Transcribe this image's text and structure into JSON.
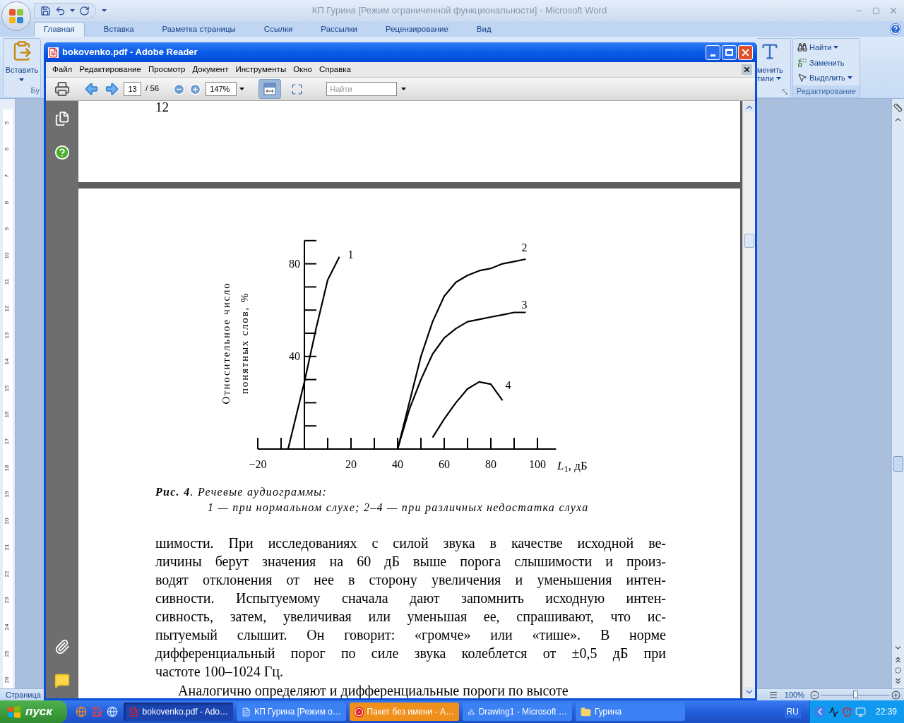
{
  "word_window": {
    "title": "КП Гурина [Режим ограниченной функциональности] - Microsoft Word",
    "tabs": [
      {
        "label": "Главная",
        "selected": true
      },
      {
        "label": "Вставка",
        "selected": false
      },
      {
        "label": "Разметка страницы",
        "selected": false
      },
      {
        "label": "Ссылки",
        "selected": false
      },
      {
        "label": "Рассылки",
        "selected": false
      },
      {
        "label": "Рецензирование",
        "selected": false
      },
      {
        "label": "Вид",
        "selected": false
      }
    ],
    "ribbon": {
      "paste_label": "Вставить",
      "clipboard_group_label": "Бу",
      "styles_label_lines": [
        "менить",
        "тили"
      ],
      "find": "Найти",
      "replace": "Заменить",
      "select": "Выделить",
      "editing_group_label": "Редактирование"
    },
    "ruler_numbers": [
      "5",
      "6",
      "7",
      "8",
      "9",
      "10",
      "11",
      "12",
      "13",
      "14",
      "15",
      "16",
      "17",
      "18",
      "19",
      "20",
      "21",
      "22",
      "23",
      "24",
      "25",
      "26"
    ],
    "status_bar": {
      "page": "Страница",
      "zoom": "100%",
      "zoom_slider": {
        "level": 0.5
      }
    }
  },
  "reader_window": {
    "title": "bokovenko.pdf - Adobe Reader",
    "menu": [
      "Файл",
      "Редактирование",
      "Просмотр",
      "Документ",
      "Инструменты",
      "Окно",
      "Справка"
    ],
    "toolbar": {
      "page": "13",
      "page_count": "/ 56",
      "zoom": "147%",
      "search_placeholder": "Найти",
      "toggles": [
        {
          "kind": "fit-width",
          "selected": true
        },
        {
          "kind": "fit-page",
          "selected": false
        }
      ]
    },
    "document": {
      "prev_page_number": "12",
      "figure": {
        "chart_data": {
          "type": "line",
          "xlabel": "*L*$_{1}$, дБ",
          "ylabel": "Относительное  число понятных слов, %",
          "x": [
            -10,
            -7,
            0,
            5,
            10,
            15,
            40,
            45,
            50,
            55,
            60,
            65,
            70,
            75,
            80,
            85,
            90,
            95
          ],
          "series": [
            {
              "name": "1",
              "color": "#000000",
              "values": [
                0,
                0,
                29,
                52,
                73,
                83,
                null,
                null,
                null,
                null,
                null,
                null,
                null,
                null,
                null,
                null,
                null,
                null
              ]
            },
            {
              "name": "2",
              "color": "#000000",
              "values": [
                null,
                null,
                null,
                null,
                null,
                null,
                0,
                20,
                40,
                55,
                66,
                72,
                75,
                77,
                78,
                80,
                81,
                82
              ]
            },
            {
              "name": "3",
              "color": "#000000",
              "values": [
                null,
                null,
                null,
                null,
                null,
                null,
                0,
                17,
                30,
                41,
                48,
                52,
                55,
                56,
                57,
                58,
                59,
                59
              ]
            },
            {
              "name": "4",
              "color": "#000000",
              "values": [
                null,
                null,
                null,
                null,
                null,
                null,
                null,
                null,
                null,
                5,
                13,
                20,
                26,
                29,
                28,
                21,
                null,
                null
              ]
            }
          ],
          "xlim": [
            -20,
            108
          ],
          "ylim": [
            0,
            90
          ],
          "xticks": [
            {
              "value": -20,
              "label": "−20"
            },
            20,
            40,
            60,
            80,
            100
          ],
          "yticks": [
            40,
            80
          ]
        },
        "caption_title": "**Рис. 4**. Речевые аудиограммы:",
        "caption_legend": "1 — при нормальном слухе; 2–4 — при различных недостатка слуха"
      },
      "body_lines": [
        "шимости. При исследованиях с силой звука в качестве исходной ве-",
        "личины берут значения на 60 дБ выше порога слышимости и произ-",
        "водят отклонения от нее в сторону увеличения и уменьшения интен-",
        "сивности. Испытуемому сначала дают запомнить исходную интен-",
        "сивность, затем, увеличивая или уменьшая ее, спрашивают, что ис-",
        "пытуемый слышит. Он говорит: «громче» или «тише». В норме",
        "дифференциальный порог по силе звука колеблется от ±0,5 дБ при",
        "частоте 100–1024 Гц."
      ],
      "next_paragraph": "Аналогично определяют и дифференциальные пороги по высоте"
    }
  },
  "taskbar": {
    "start_label": "пуск",
    "tasks": [
      {
        "kind": "pdf",
        "label": "bokovenko.pdf - Ado…",
        "selected": true,
        "flashing": false
      },
      {
        "kind": "word",
        "label": "КП Гурина [Режим о…",
        "selected": false,
        "flashing": false
      },
      {
        "kind": "app",
        "label": "Пакет без имени - А…",
        "selected": false,
        "flashing": true
      },
      {
        "kind": "drawing",
        "label": "Drawing1 - Microsoft …",
        "selected": false,
        "flashing": false
      },
      {
        "kind": "folder",
        "label": "Гурина",
        "selected": false,
        "flashing": false
      }
    ],
    "language": "RU",
    "clock": "22:39"
  }
}
